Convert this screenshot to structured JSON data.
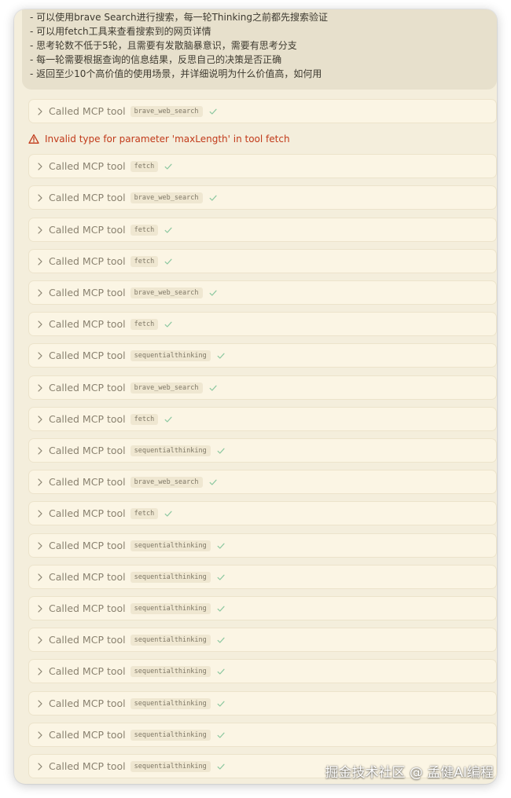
{
  "message": {
    "lines": [
      "- 可以使用brave Search进行搜索，每一轮Thinking之前都先搜索验证",
      "- 可以用fetch工具来查看搜索到的网页详情",
      "- 思考轮数不低于5轮，且需要有发散脑暴意识，需要有思考分支",
      "- 每一轮需要根据查询的信息结果，反思自己的决策是否正确",
      "- 返回至少10个高价值的使用场景，并详细说明为什么价值高，如何用"
    ]
  },
  "error": {
    "text": "Invalid type for parameter 'maxLength' in tool fetch",
    "icon": "warning-triangle-icon",
    "color": "#c13a1a"
  },
  "calls": [
    {
      "label": "Called MCP tool",
      "tool": "brave_web_search",
      "status": "check-icon"
    },
    {
      "label": "Called MCP tool",
      "tool": "fetch",
      "status": "check-icon"
    },
    {
      "label": "Called MCP tool",
      "tool": "brave_web_search",
      "status": "check-icon"
    },
    {
      "label": "Called MCP tool",
      "tool": "fetch",
      "status": "check-icon"
    },
    {
      "label": "Called MCP tool",
      "tool": "fetch",
      "status": "check-icon"
    },
    {
      "label": "Called MCP tool",
      "tool": "brave_web_search",
      "status": "check-icon"
    },
    {
      "label": "Called MCP tool",
      "tool": "fetch",
      "status": "check-icon"
    },
    {
      "label": "Called MCP tool",
      "tool": "sequentialthinking",
      "status": "check-icon"
    },
    {
      "label": "Called MCP tool",
      "tool": "brave_web_search",
      "status": "check-icon"
    },
    {
      "label": "Called MCP tool",
      "tool": "fetch",
      "status": "check-icon"
    },
    {
      "label": "Called MCP tool",
      "tool": "sequentialthinking",
      "status": "check-icon"
    },
    {
      "label": "Called MCP tool",
      "tool": "brave_web_search",
      "status": "check-icon"
    },
    {
      "label": "Called MCP tool",
      "tool": "fetch",
      "status": "check-icon"
    },
    {
      "label": "Called MCP tool",
      "tool": "sequentialthinking",
      "status": "check-icon"
    },
    {
      "label": "Called MCP tool",
      "tool": "sequentialthinking",
      "status": "check-icon"
    },
    {
      "label": "Called MCP tool",
      "tool": "sequentialthinking",
      "status": "check-icon"
    },
    {
      "label": "Called MCP tool",
      "tool": "sequentialthinking",
      "status": "check-icon"
    },
    {
      "label": "Called MCP tool",
      "tool": "sequentialthinking",
      "status": "check-icon"
    },
    {
      "label": "Called MCP tool",
      "tool": "sequentialthinking",
      "status": "check-icon"
    },
    {
      "label": "Called MCP tool",
      "tool": "sequentialthinking",
      "status": "check-icon"
    },
    {
      "label": "Called MCP tool",
      "tool": "sequentialthinking",
      "status": "check-icon"
    }
  ],
  "watermark": "掘金技术社区 @ 孟健AI编程",
  "colors": {
    "background": "#f4eedc",
    "row": "#fbf5e4",
    "check": "#8cc8a0"
  }
}
